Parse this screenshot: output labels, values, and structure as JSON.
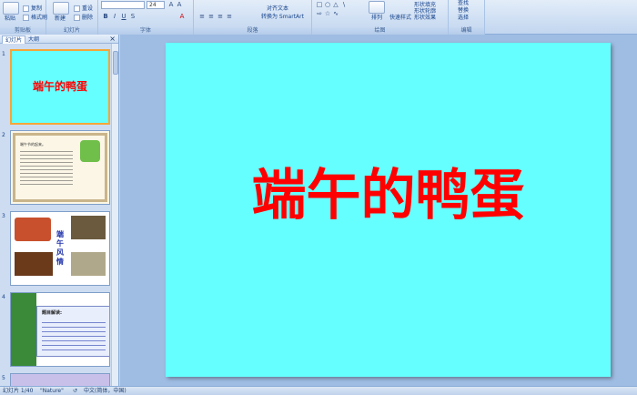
{
  "ribbon": {
    "clipboard": {
      "label": "剪贴板",
      "paste": "粘贴",
      "copy": "复制",
      "format_painter": "格式刷"
    },
    "slides": {
      "label": "幻灯片",
      "new_slide": "新建",
      "reset": "重设",
      "delete": "删除"
    },
    "font": {
      "label": "字体",
      "font_size": "24"
    },
    "paragraph": {
      "label": "段落",
      "align_text": "对齐文本",
      "convert_smartart": "转换为 SmartArt"
    },
    "drawing": {
      "label": "绘图",
      "arrange": "排列",
      "quick_styles": "快速样式",
      "shape_fill": "形状填充",
      "shape_outline": "形状轮廓",
      "shape_effects": "形状效果"
    },
    "editing": {
      "label": "编辑",
      "find": "查找",
      "replace": "替换",
      "select": "选择"
    }
  },
  "left_panel": {
    "tab_slides": "幻灯片",
    "tab_outline": "大纲",
    "close": "×",
    "thumbnails": [
      {
        "num": "1",
        "title": "端午的鸭蛋"
      },
      {
        "num": "2",
        "text": "端午节的起来。"
      },
      {
        "num": "3",
        "title": "端午风情"
      },
      {
        "num": "4",
        "heading": "题目解读:"
      },
      {
        "num": "5"
      }
    ]
  },
  "slide": {
    "title": "端午的鸭蛋"
  },
  "statusbar": {
    "slide_count": "幻灯片 1/40",
    "theme": "\"Nature\"",
    "language": "中文(简体，中国)"
  },
  "colors": {
    "slide_bg": "#66ffff",
    "title": "#ff0000",
    "selection": "#f3a63a"
  }
}
